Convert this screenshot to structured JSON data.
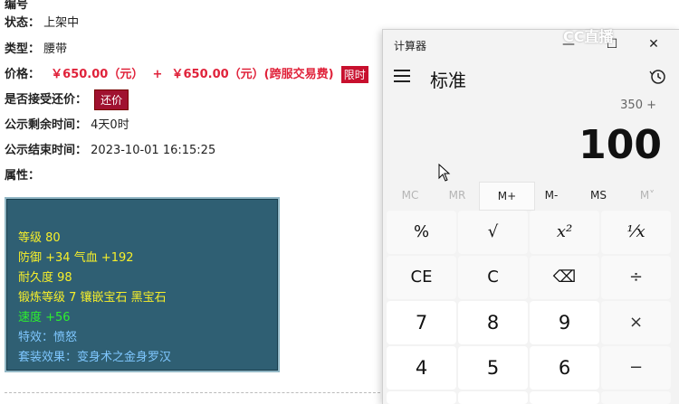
{
  "page": {
    "status_label": "状态：",
    "status_value": "上架中",
    "type_label": "类型：",
    "type_value": "腰带",
    "price_label": "价格：",
    "price_value": "￥650.00（元）",
    "price_plus": "+",
    "price_cross": "￥650.00（元）(跨服交易费)",
    "limit_tag": "限时",
    "counter_label": "是否接受还价：",
    "counter_button": "还价",
    "remain_label": "公示剩余时间：",
    "remain_value": "4天0时",
    "end_label": "公示结束时间：",
    "end_value": "2023-10-01 16:15:25",
    "attr_label": "属性：",
    "attributes": [
      {
        "text": "等级 80",
        "color": "yellow"
      },
      {
        "text": "防御 +34 气血 +192",
        "color": "yellow"
      },
      {
        "text": "耐久度 98",
        "color": "yellow"
      },
      {
        "text": "锻炼等级 7 镶嵌宝石 黑宝石",
        "color": "yellow"
      },
      {
        "text": "速度 +56",
        "color": "green"
      },
      {
        "text": "特效：愤怒",
        "color": "blue"
      },
      {
        "text": "套装效果：变身术之金身罗汉",
        "color": "blue"
      }
    ]
  },
  "watermark": "CC直播",
  "calculator": {
    "app_title": "计算器",
    "minimize": "—",
    "maximize": "☐",
    "close": "✕",
    "mode": "标准",
    "expression": "350 +",
    "display": "100",
    "memory": [
      "MC",
      "MR",
      "M+",
      "M-",
      "MS",
      "M˅"
    ],
    "keys": [
      [
        "%",
        "√",
        "x²",
        "⅟x"
      ],
      [
        "CE",
        "C",
        "⌫",
        "÷"
      ],
      [
        "7",
        "8",
        "9",
        "×"
      ],
      [
        "4",
        "5",
        "6",
        "−"
      ]
    ],
    "colors": {
      "bg": "#f3f3f3",
      "num_key": "#ffffff",
      "fn_key": "#f9f9f9"
    }
  }
}
